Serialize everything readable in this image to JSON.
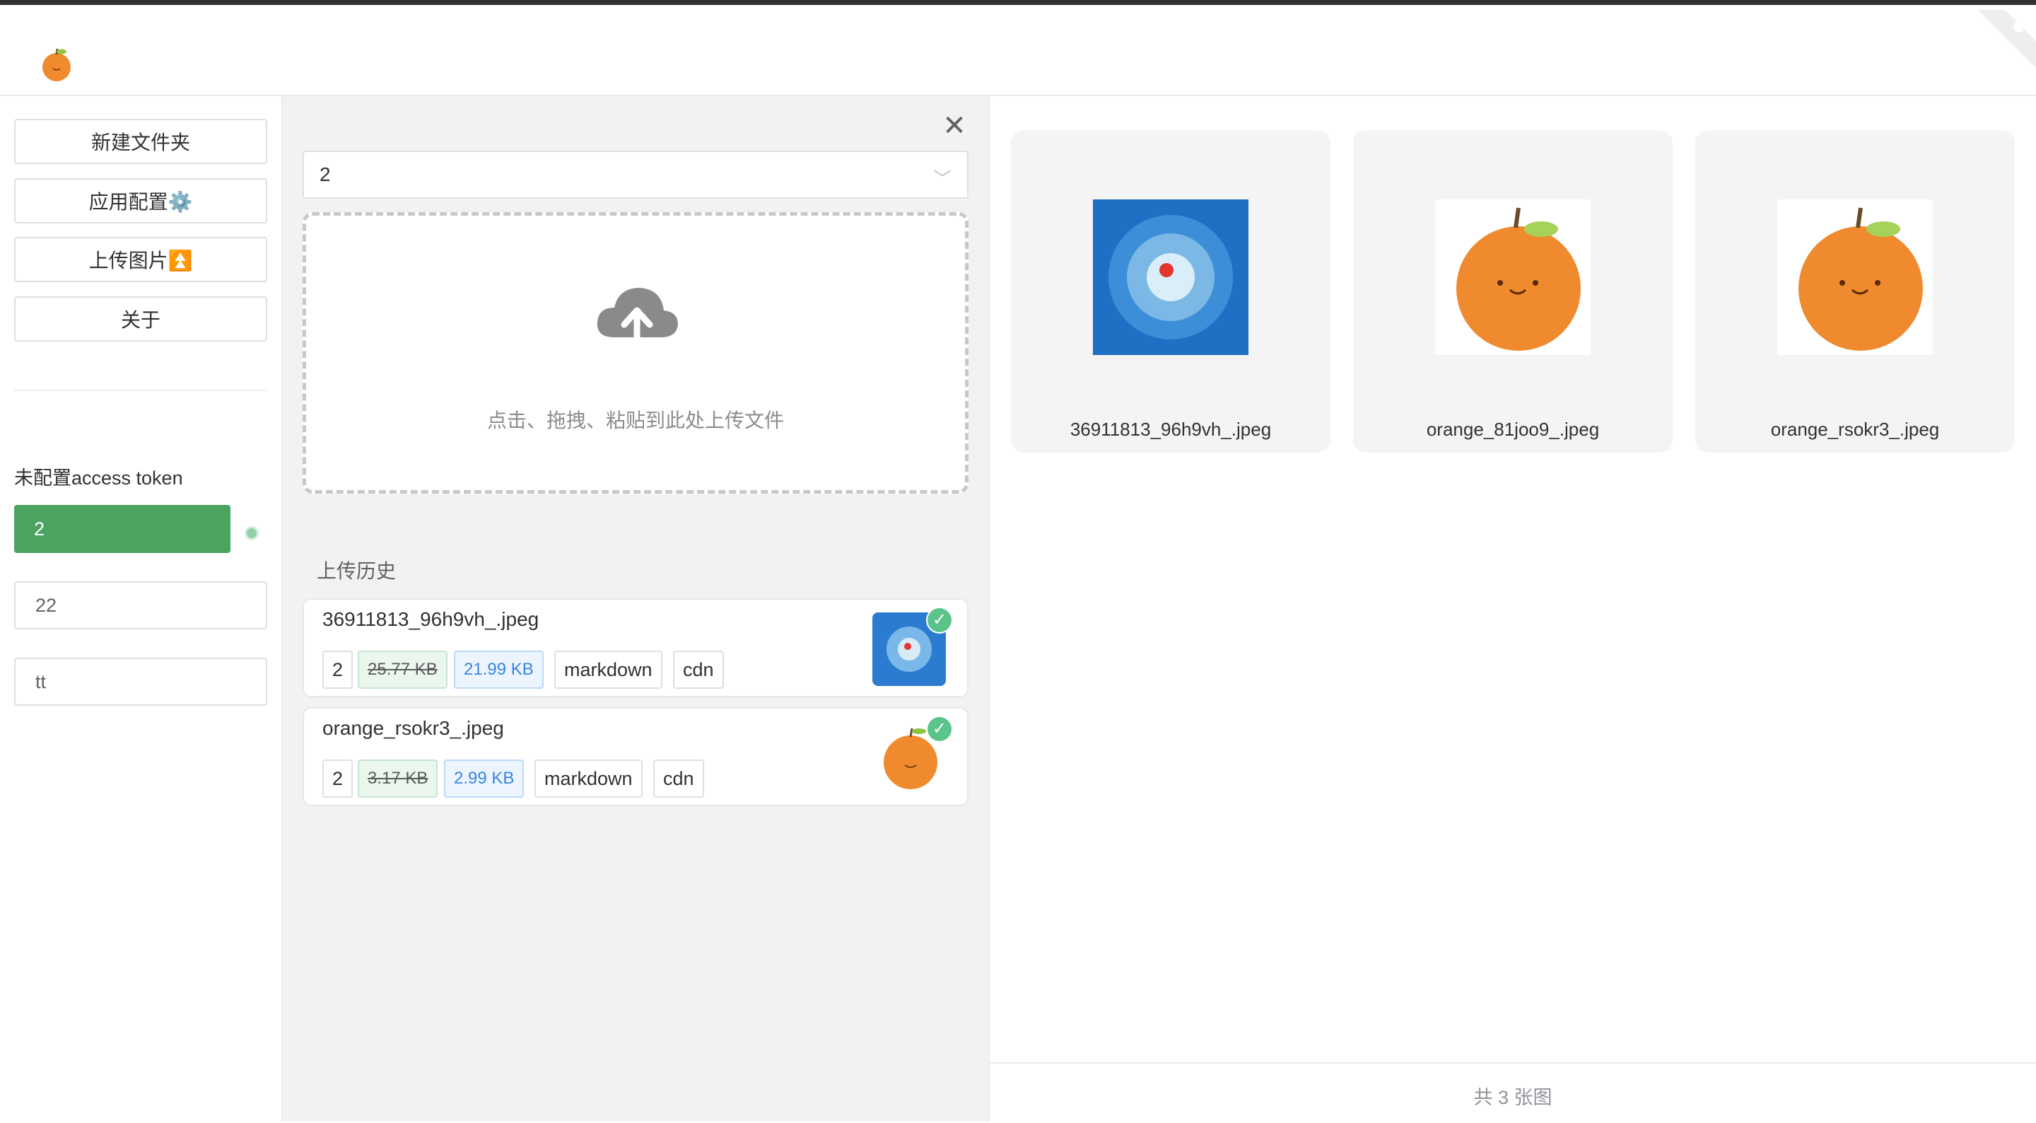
{
  "sidebar": {
    "buttons": [
      {
        "label": "新建文件夹"
      },
      {
        "label": "应用配置⚙️"
      },
      {
        "label": "上传图片⏫"
      },
      {
        "label": "关于"
      }
    ],
    "token_label": "未配置access token",
    "repo_selected": "2",
    "inputs": [
      "22",
      "tt"
    ]
  },
  "upload": {
    "close_icon": "close-icon",
    "select_value": "2",
    "dropzone_text": "点击、拖拽、粘贴到此处上传文件",
    "history_title": "上传历史",
    "history": [
      {
        "name": "36911813_96h9vh_.jpeg",
        "repo": "2",
        "old_size": "25.77 KB",
        "new_size": "21.99 KB",
        "btn_md": "markdown",
        "btn_cdn": "cdn"
      },
      {
        "name": "orange_rsokr3_.jpeg",
        "repo": "2",
        "old_size": "3.17 KB",
        "new_size": "2.99 KB",
        "btn_md": "markdown",
        "btn_cdn": "cdn"
      }
    ]
  },
  "gallery": {
    "items": [
      {
        "name": "36911813_96h9vh_.jpeg"
      },
      {
        "name": "orange_81joo9_.jpeg"
      },
      {
        "name": "orange_rsokr3_.jpeg"
      }
    ],
    "footer": "共 3 张图"
  },
  "colors": {
    "accent_green": "#4aa35f",
    "check_green": "#5bc48a",
    "size_blue": "#3a86e0"
  }
}
